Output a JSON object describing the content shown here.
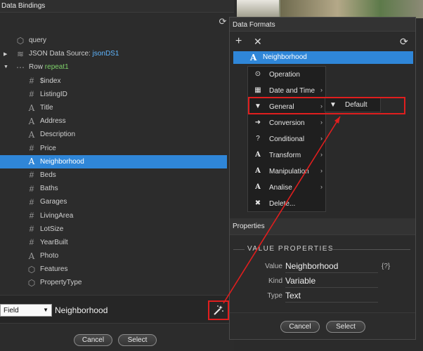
{
  "left_panel": {
    "title": "Data Bindings",
    "tree": [
      {
        "label": "query",
        "icon": "cube-icon",
        "indent": 1
      },
      {
        "label": "JSON Data Source: ",
        "accent": "jsonDS1",
        "icon": "database-icon",
        "indent": 1,
        "expander": "▶"
      },
      {
        "label": "Row ",
        "green": "repeat1",
        "icon": "ellipsis-icon",
        "indent": 1,
        "expander": "▼"
      },
      {
        "label": "$index",
        "icon": "hash-icon",
        "indent": 2
      },
      {
        "label": "ListingID",
        "icon": "hash-icon",
        "indent": 2
      },
      {
        "label": "Title",
        "icon": "text-icon",
        "indent": 2
      },
      {
        "label": "Address",
        "icon": "text-icon",
        "indent": 2
      },
      {
        "label": "Description",
        "icon": "text-icon",
        "indent": 2
      },
      {
        "label": "Price",
        "icon": "hash-icon",
        "indent": 2
      },
      {
        "label": "Neighborhood",
        "icon": "text-icon",
        "indent": 2,
        "selected": true
      },
      {
        "label": "Beds",
        "icon": "hash-icon",
        "indent": 2
      },
      {
        "label": "Baths",
        "icon": "hash-icon",
        "indent": 2
      },
      {
        "label": "Garages",
        "icon": "hash-icon",
        "indent": 2
      },
      {
        "label": "LivingArea",
        "icon": "hash-icon",
        "indent": 2
      },
      {
        "label": "LotSize",
        "icon": "hash-icon",
        "indent": 2
      },
      {
        "label": "YearBuilt",
        "icon": "hash-icon",
        "indent": 2
      },
      {
        "label": "Photo",
        "icon": "text-icon",
        "indent": 2
      },
      {
        "label": "Features",
        "icon": "cube-icon",
        "indent": 2
      },
      {
        "label": "PropertyType",
        "icon": "cube-icon",
        "indent": 2
      }
    ],
    "field_select": "Field",
    "field_value": "Neighborhood",
    "cancel_label": "Cancel",
    "select_label": "Select"
  },
  "dialog": {
    "title": "Data Formats",
    "selected_item": "Neighborhood",
    "menu": [
      {
        "label": "Operation",
        "icon": "operation-icon",
        "submenu": false
      },
      {
        "label": "Date and Time",
        "icon": "calendar-icon",
        "submenu": true
      },
      {
        "label": "General",
        "icon": "funnel-icon",
        "submenu": true
      },
      {
        "label": "Conversion",
        "icon": "arrow-right-icon",
        "submenu": true
      },
      {
        "label": "Conditional",
        "icon": "question-icon",
        "submenu": true
      },
      {
        "label": "Transform",
        "icon": "text-icon",
        "submenu": true
      },
      {
        "label": "Manipulation",
        "icon": "text-icon",
        "submenu": true
      },
      {
        "label": "Analise",
        "icon": "text-icon",
        "submenu": true
      },
      {
        "label": "Delete...",
        "icon": "close-icon",
        "submenu": false
      }
    ],
    "submenu_item": "Default",
    "properties_title": "Properties",
    "value_properties_title": "VALUE PROPERTIES",
    "properties": [
      {
        "key": "Value",
        "value": "Neighborhood"
      },
      {
        "key": "Kind",
        "value": "Variable"
      },
      {
        "key": "Type",
        "value": "Text"
      }
    ],
    "value_icon": "{?}",
    "cancel_label": "Cancel",
    "select_label": "Select"
  },
  "colors": {
    "selection": "#2f86d8",
    "annotation": "#e01e1e",
    "panel": "#2b2b2b"
  }
}
